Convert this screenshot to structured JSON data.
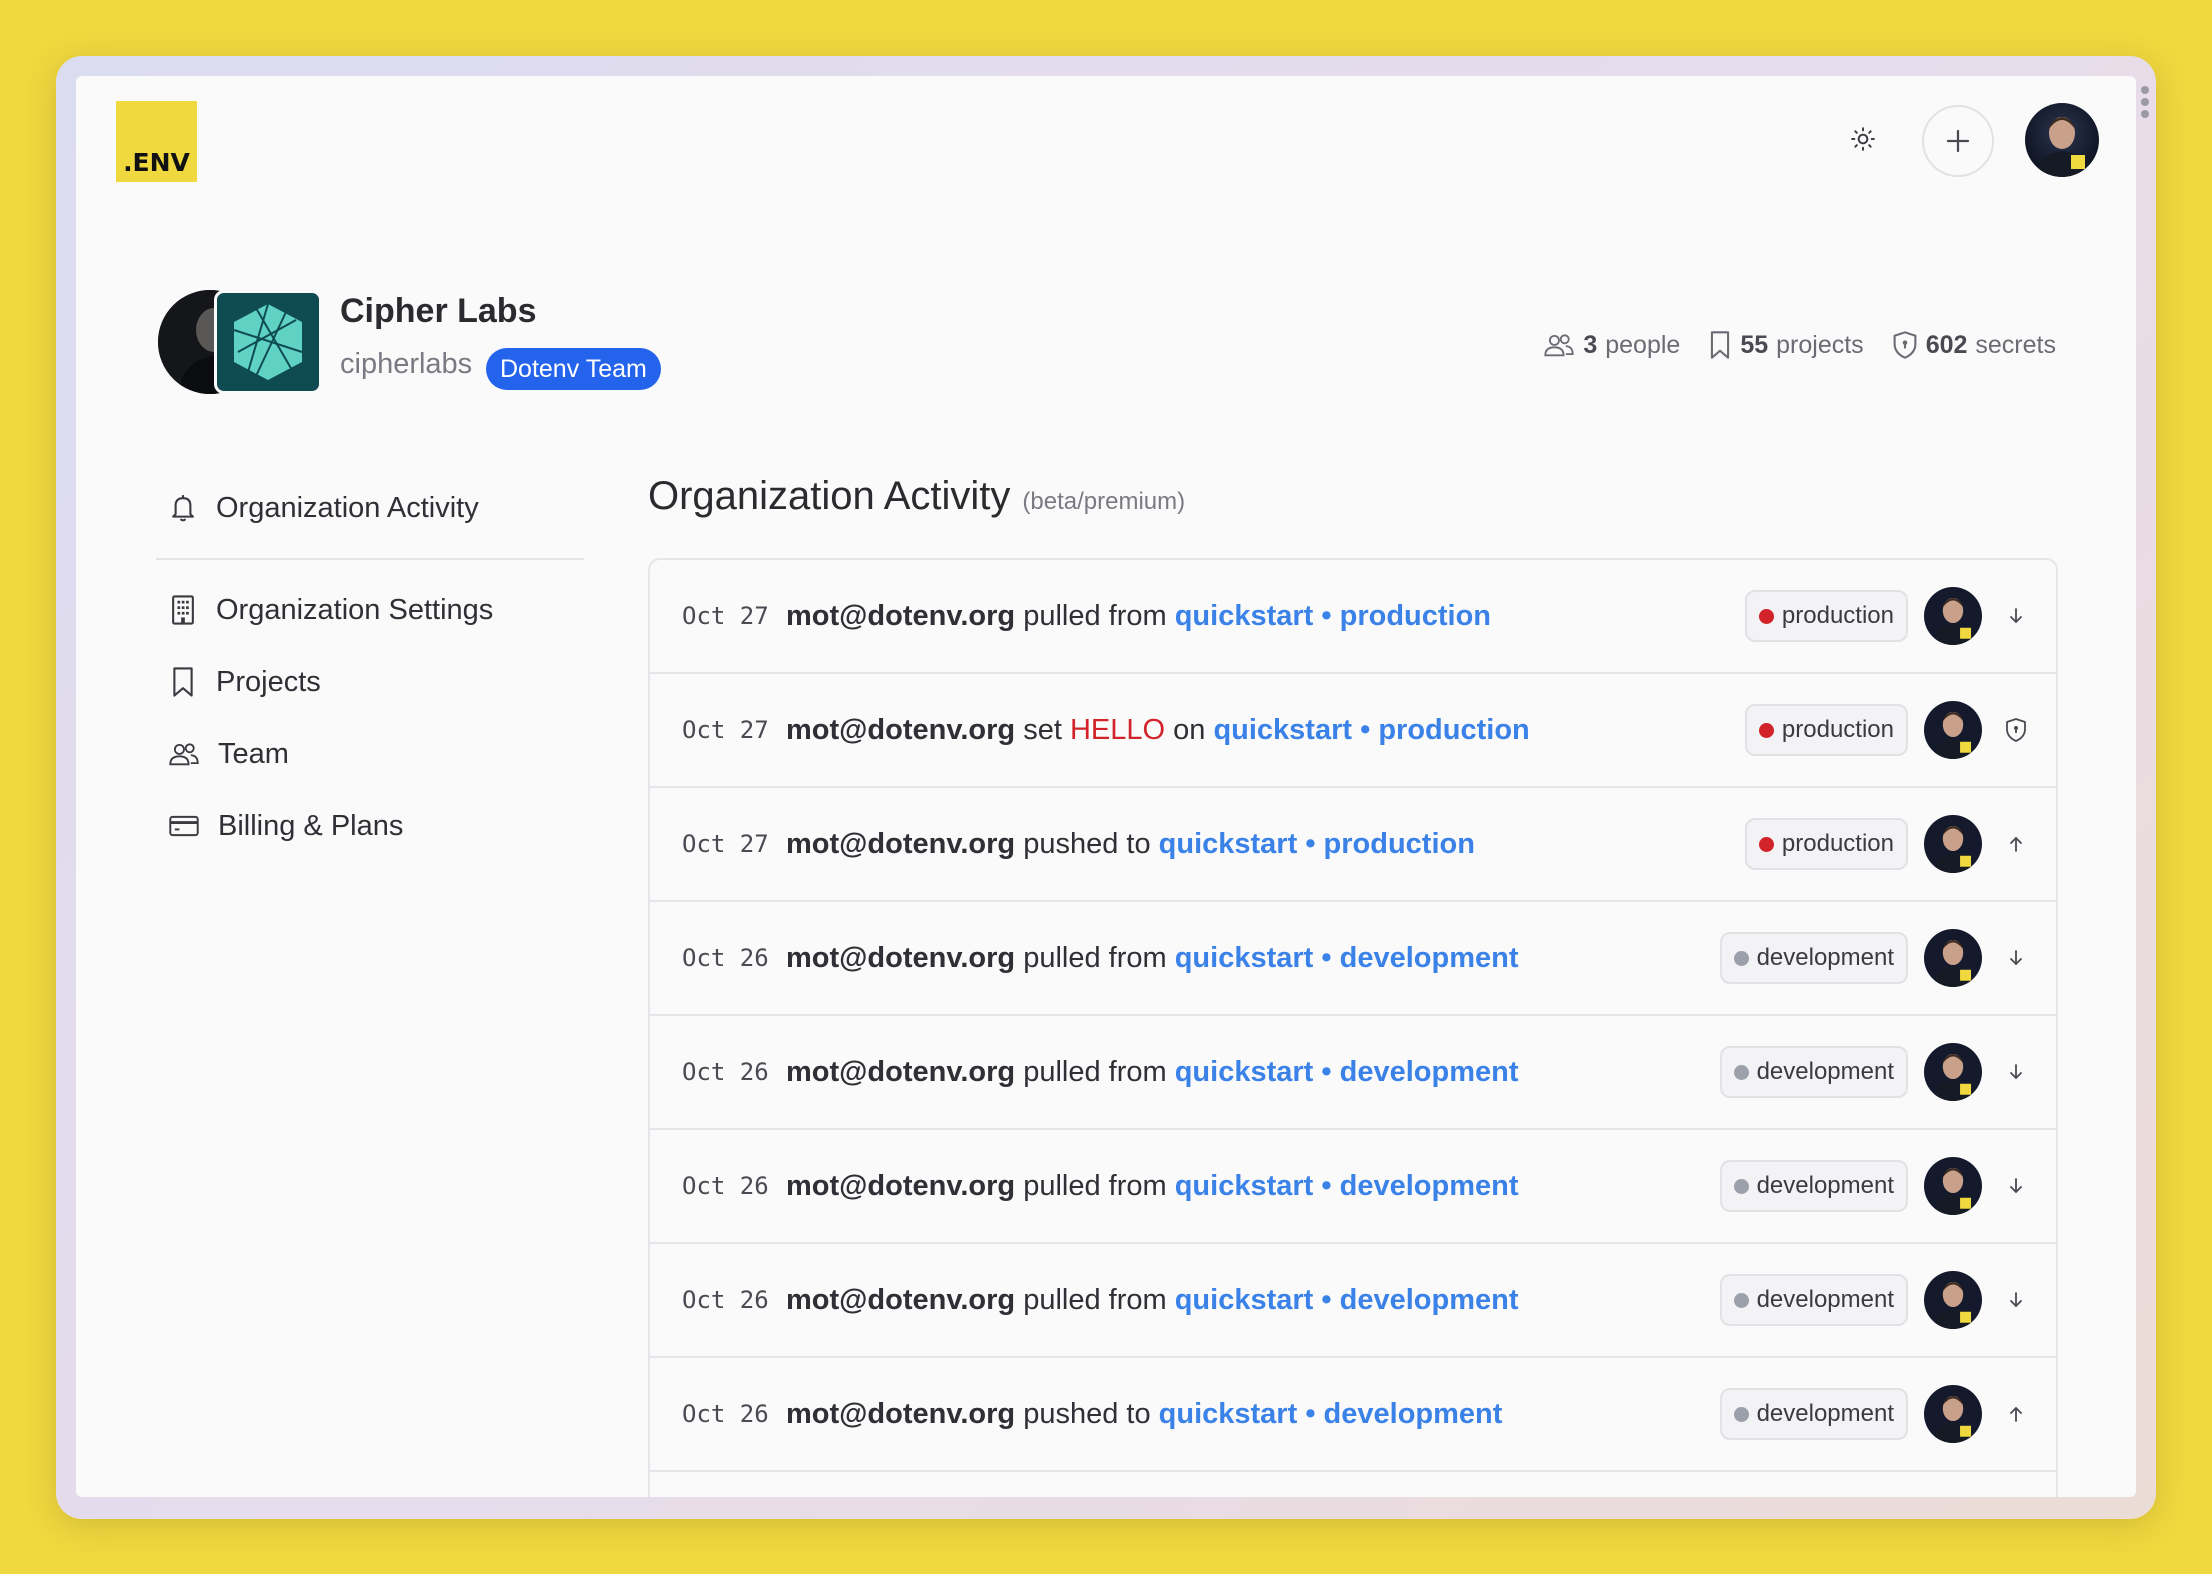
{
  "app": {
    "logo_text": ".ENV"
  },
  "org": {
    "name": "Cipher Labs",
    "slug": "cipherlabs",
    "badge": "Dotenv Team",
    "stats": {
      "people_count": "3",
      "people_label": "people",
      "projects_count": "55",
      "projects_label": "projects",
      "secrets_count": "602",
      "secrets_label": "secrets"
    }
  },
  "sidebar": {
    "top_item": {
      "label": "Organization Activity",
      "icon": "bell-icon"
    },
    "items": [
      {
        "label": "Organization Settings",
        "icon": "building-icon"
      },
      {
        "label": "Projects",
        "icon": "bookmark-icon"
      },
      {
        "label": "Team",
        "icon": "users-icon"
      },
      {
        "label": "Billing & Plans",
        "icon": "credit-card-icon"
      }
    ]
  },
  "main": {
    "title": "Organization Activity",
    "subtitle": "(beta/premium)"
  },
  "colors": {
    "accent_yellow": "#f0d83f",
    "link_blue": "#3b82e8",
    "badge_blue": "#2463eb",
    "production_red": "#d3232a",
    "development_gray": "#9ca0aa"
  },
  "activity": [
    {
      "date": "Oct 27",
      "actor": "mot@dotenv.org",
      "verb": "pulled from",
      "key": "",
      "on": "",
      "project": "quickstart",
      "sep": "•",
      "env": "production",
      "tag": "production",
      "action_icon": "arrow-down-icon"
    },
    {
      "date": "Oct 27",
      "actor": "mot@dotenv.org",
      "verb": "set",
      "key": "HELLO",
      "on": "on",
      "project": "quickstart",
      "sep": "•",
      "env": "production",
      "tag": "production",
      "action_icon": "shield-icon"
    },
    {
      "date": "Oct 27",
      "actor": "mot@dotenv.org",
      "verb": "pushed to",
      "key": "",
      "on": "",
      "project": "quickstart",
      "sep": "•",
      "env": "production",
      "tag": "production",
      "action_icon": "arrow-up-icon"
    },
    {
      "date": "Oct 26",
      "actor": "mot@dotenv.org",
      "verb": "pulled from",
      "key": "",
      "on": "",
      "project": "quickstart",
      "sep": "•",
      "env": "development",
      "tag": "development",
      "action_icon": "arrow-down-icon"
    },
    {
      "date": "Oct 26",
      "actor": "mot@dotenv.org",
      "verb": "pulled from",
      "key": "",
      "on": "",
      "project": "quickstart",
      "sep": "•",
      "env": "development",
      "tag": "development",
      "action_icon": "arrow-down-icon"
    },
    {
      "date": "Oct 26",
      "actor": "mot@dotenv.org",
      "verb": "pulled from",
      "key": "",
      "on": "",
      "project": "quickstart",
      "sep": "•",
      "env": "development",
      "tag": "development",
      "action_icon": "arrow-down-icon"
    },
    {
      "date": "Oct 26",
      "actor": "mot@dotenv.org",
      "verb": "pulled from",
      "key": "",
      "on": "",
      "project": "quickstart",
      "sep": "•",
      "env": "development",
      "tag": "development",
      "action_icon": "arrow-down-icon"
    },
    {
      "date": "Oct 26",
      "actor": "mot@dotenv.org",
      "verb": "pushed to",
      "key": "",
      "on": "",
      "project": "quickstart",
      "sep": "•",
      "env": "development",
      "tag": "development",
      "action_icon": "arrow-up-icon"
    }
  ]
}
